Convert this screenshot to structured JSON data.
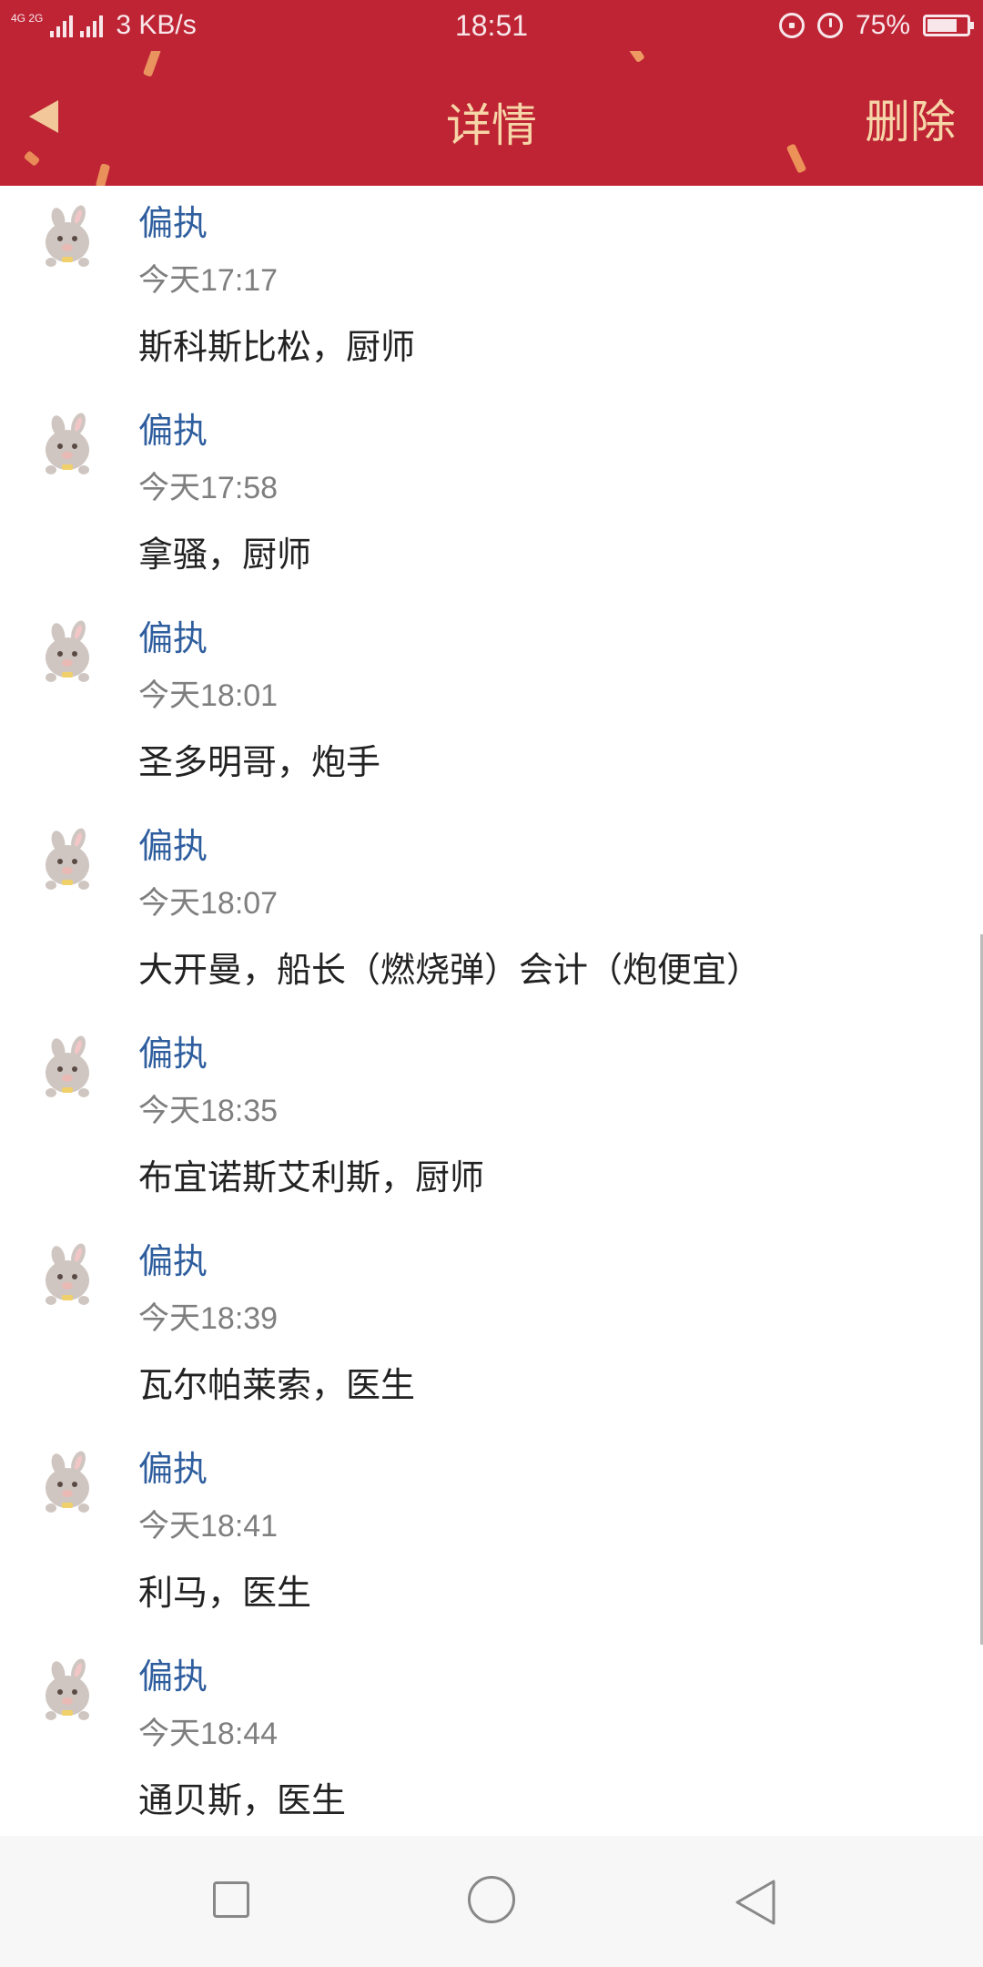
{
  "status_bar": {
    "network_badge": "4G 2G",
    "speed": "3 KB/s",
    "time": "18:51",
    "battery": "75%",
    "battery_level": 0.75
  },
  "header": {
    "title": "详情",
    "delete_label": "删除",
    "background_color": "#bf2435",
    "text_color": "#f6d6a8"
  },
  "messages": [
    {
      "sender": "偏执",
      "time": "今天17:17",
      "text": "斯科斯比松，厨师"
    },
    {
      "sender": "偏执",
      "time": "今天17:58",
      "text": "拿骚，厨师"
    },
    {
      "sender": "偏执",
      "time": "今天18:01",
      "text": "圣多明哥，炮手"
    },
    {
      "sender": "偏执",
      "time": "今天18:07",
      "text": "大开曼，船长（燃烧弹）会计（炮便宜）"
    },
    {
      "sender": "偏执",
      "time": "今天18:35",
      "text": "布宜诺斯艾利斯，厨师"
    },
    {
      "sender": "偏执",
      "time": "今天18:39",
      "text": "瓦尔帕莱索，医生"
    },
    {
      "sender": "偏执",
      "time": "今天18:41",
      "text": "利马，医生"
    },
    {
      "sender": "偏执",
      "time": "今天18:44",
      "text": "通贝斯，医生"
    }
  ],
  "nav": {
    "icons": [
      "recent-apps-icon",
      "home-icon",
      "back-icon"
    ]
  }
}
